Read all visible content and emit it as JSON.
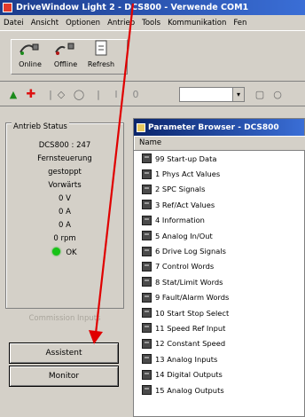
{
  "window": {
    "title": "DriveWindow Light 2 - DCS800 - Verwende COM1"
  },
  "menu": [
    "Datei",
    "Ansicht",
    "Optionen",
    "Antrieb",
    "Tools",
    "Kommunikation",
    "Fen"
  ],
  "toolbar": {
    "online_label": "Online",
    "offline_label": "Offline",
    "refresh_label": "Refresh"
  },
  "status": {
    "title": "Antrieb Status",
    "lines": [
      "DCS800 : 247",
      "Fernsteuerung",
      "gestoppt",
      "Vorwärts",
      "0 V",
      "0 A",
      "0 A",
      "0 rpm"
    ],
    "ok_label": "OK",
    "ok_color": "#17c317"
  },
  "inactive_label": "Commission Inputs",
  "buttons": {
    "assistant": "Assistent",
    "monitor": "Monitor"
  },
  "browser": {
    "title": "Parameter Browser - DCS800",
    "column": "Name",
    "items": [
      "99 Start-up Data",
      "1 Phys Act Values",
      "2 SPC Signals",
      "3 Ref/Act Values",
      "4 Information",
      "5 Analog In/Out",
      "6 Drive Log Signals",
      "7 Control Words",
      "8 Stat/Limit Words",
      "9 Fault/Alarm Words",
      "10 Start Stop Select",
      "11 Speed Ref Input",
      "12 Constant Speed",
      "13 Analog Inputs",
      "14 Digital Outputs",
      "15 Analog Outputs"
    ]
  },
  "accent": "#e00000"
}
